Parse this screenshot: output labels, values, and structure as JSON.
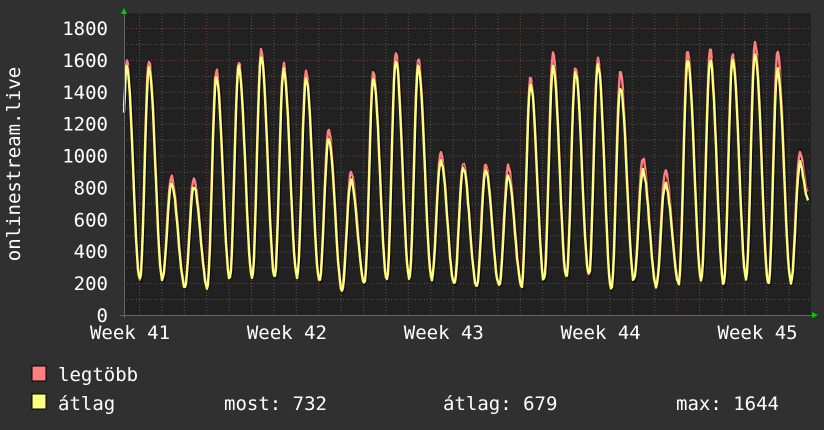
{
  "chart_data": {
    "type": "line",
    "ylabel": "onlinestream.live",
    "xlabel": "",
    "ylim": [
      0,
      1800
    ],
    "yticks": [
      "0",
      "200",
      "400",
      "600",
      "800",
      "1000",
      "1200",
      "1400",
      "1600",
      "1800"
    ],
    "xticks": [
      "Week 41",
      "Week 42",
      "Week 43",
      "Week 44",
      "Week 45"
    ],
    "x_unit": "day",
    "grid": true,
    "background": "#212121",
    "outer_background": "#303030",
    "series": [
      {
        "name": "legtöbb",
        "color": "#ff7f7f",
        "start_value": 1300,
        "daily_peaks": [
          1604,
          1596,
          872,
          855,
          1533,
          1585,
          1658,
          1571,
          1520,
          1165,
          899,
          1526,
          1635,
          1610,
          1008,
          955,
          945,
          930,
          1491,
          1641,
          1558,
          1610,
          1522,
          989,
          910,
          1658,
          1662,
          1641,
          1708,
          1648,
          1025
        ],
        "daily_troughs": [
          232,
          232,
          192,
          187,
          237,
          247,
          252,
          247,
          221,
          170,
          207,
          237,
          242,
          237,
          202,
          190,
          197,
          197,
          230,
          246,
          262,
          170,
          230,
          197,
          214,
          240,
          206,
          246,
          214,
          214
        ],
        "end_value": 760
      },
      {
        "name": "átlag",
        "color": "#ffff7f",
        "start_value": 1280,
        "daily_peaks": [
          1579,
          1547,
          826,
          805,
          1491,
          1558,
          1616,
          1537,
          1485,
          1098,
          847,
          1485,
          1600,
          1558,
          972,
          920,
          899,
          868,
          1453,
          1558,
          1516,
          1569,
          1432,
          910,
          826,
          1600,
          1600,
          1600,
          1641,
          1537,
          952
        ],
        "daily_troughs": [
          220,
          220,
          180,
          175,
          225,
          235,
          240,
          235,
          209,
          157,
          195,
          225,
          230,
          225,
          190,
          178,
          185,
          185,
          218,
          234,
          250,
          157,
          218,
          185,
          202,
          228,
          194,
          234,
          202,
          202
        ],
        "end_value": 722
      }
    ],
    "legend": {
      "items": [
        {
          "label": "legtöbb",
          "color": "#ff7f7f"
        },
        {
          "label": "átlag",
          "color": "#ffff7f"
        }
      ],
      "stats": {
        "now": "most: 732",
        "avg": "átlag: 679",
        "max": "max: 1644"
      },
      "placement": "bottom-left"
    }
  }
}
